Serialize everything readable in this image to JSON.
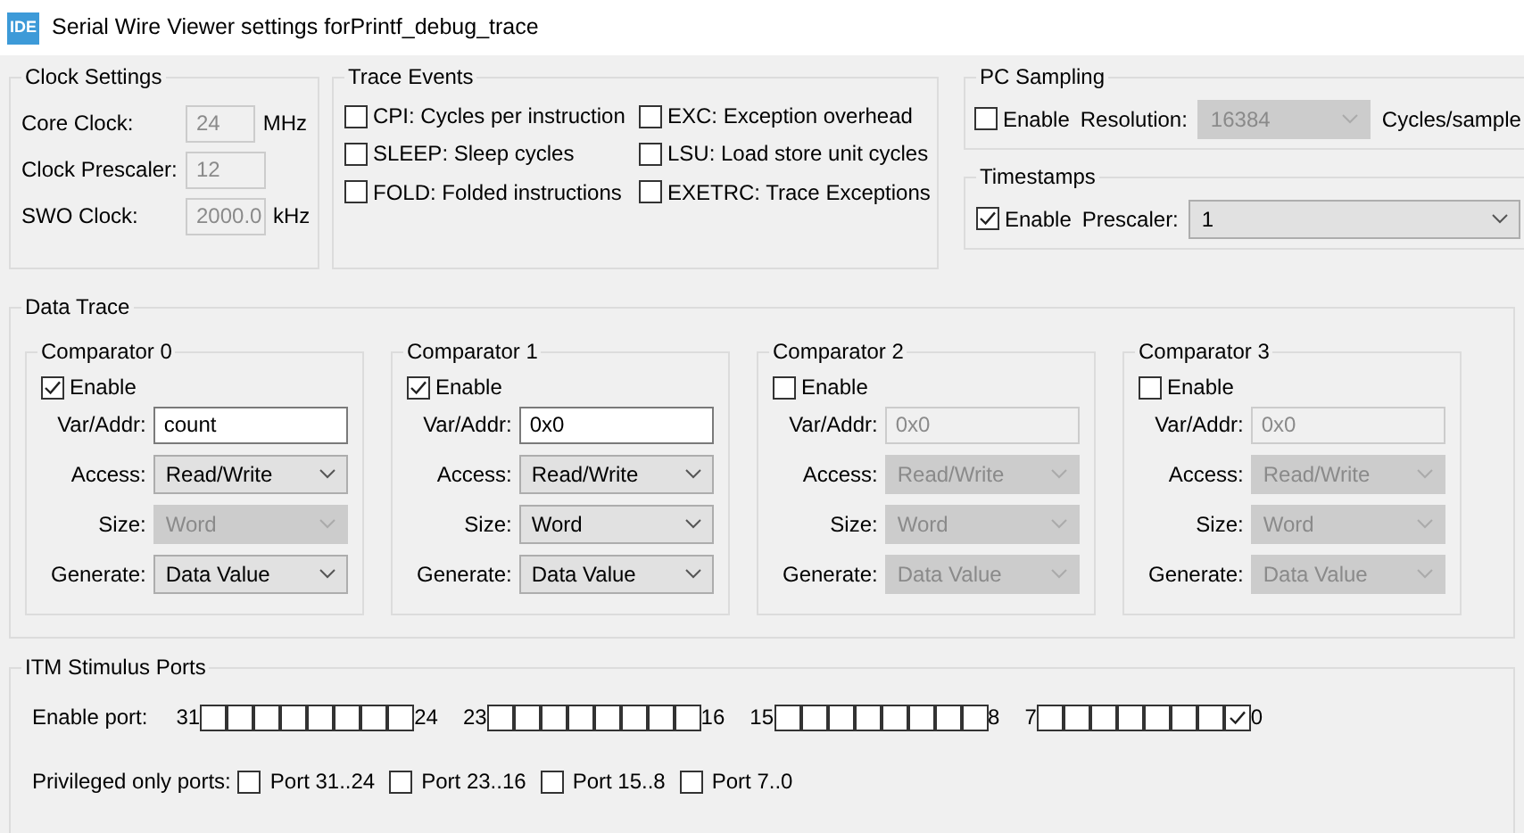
{
  "window": {
    "title": "Serial Wire Viewer settings forPrintf_debug_trace",
    "icon": "IDE"
  },
  "clock_settings": {
    "title": "Clock Settings",
    "fields": [
      {
        "label": "Core Clock:",
        "value": "24",
        "unit": "MHz"
      },
      {
        "label": "Clock Prescaler:",
        "value": "12"
      },
      {
        "label": "SWO Clock:",
        "value": "2000.0",
        "unit": "kHz"
      }
    ]
  },
  "trace_events": {
    "title": "Trace Events",
    "items": [
      {
        "label": "CPI: Cycles per instruction",
        "checked": false
      },
      {
        "label": "EXC: Exception overhead",
        "checked": false
      },
      {
        "label": "SLEEP: Sleep cycles",
        "checked": false
      },
      {
        "label": "LSU: Load store unit cycles",
        "checked": false
      },
      {
        "label": "FOLD: Folded instructions",
        "checked": false
      },
      {
        "label": "EXETRC: Trace Exceptions",
        "checked": false
      }
    ]
  },
  "pc_sampling": {
    "title": "PC Sampling",
    "enable": {
      "label": "Enable",
      "checked": false
    },
    "resolution_label": "Resolution:",
    "resolution": {
      "value": "16384",
      "disabled": true
    },
    "unit": "Cycles/sample"
  },
  "timestamps": {
    "title": "Timestamps",
    "enable": {
      "label": "Enable",
      "checked": true
    },
    "prescaler_label": "Prescaler:",
    "prescaler": {
      "value": "1",
      "disabled": false
    }
  },
  "data_trace": {
    "title": "Data Trace",
    "comparators": [
      {
        "title": "Comparator 0",
        "enable": {
          "label": "Enable",
          "checked": true
        },
        "fields": [
          {
            "label": "Var/Addr:",
            "kind": "input",
            "value": "count",
            "disabled": false
          },
          {
            "label": "Access:",
            "kind": "select",
            "value": "Read/Write",
            "disabled": false
          },
          {
            "label": "Size:",
            "kind": "select",
            "value": "Word",
            "disabled": true
          },
          {
            "label": "Generate:",
            "kind": "select",
            "value": "Data Value",
            "disabled": false
          }
        ]
      },
      {
        "title": "Comparator 1",
        "enable": {
          "label": "Enable",
          "checked": true
        },
        "fields": [
          {
            "label": "Var/Addr:",
            "kind": "input",
            "value": "0x0",
            "disabled": false
          },
          {
            "label": "Access:",
            "kind": "select",
            "value": "Read/Write",
            "disabled": false
          },
          {
            "label": "Size:",
            "kind": "select",
            "value": "Word",
            "disabled": false
          },
          {
            "label": "Generate:",
            "kind": "select",
            "value": "Data Value",
            "disabled": false
          }
        ]
      },
      {
        "title": "Comparator 2",
        "enable": {
          "label": "Enable",
          "checked": false
        },
        "fields": [
          {
            "label": "Var/Addr:",
            "kind": "input",
            "value": "0x0",
            "disabled": true
          },
          {
            "label": "Access:",
            "kind": "select",
            "value": "Read/Write",
            "disabled": true
          },
          {
            "label": "Size:",
            "kind": "select",
            "value": "Word",
            "disabled": true
          },
          {
            "label": "Generate:",
            "kind": "select",
            "value": "Data Value",
            "disabled": true
          }
        ]
      },
      {
        "title": "Comparator 3",
        "enable": {
          "label": "Enable",
          "checked": false
        },
        "fields": [
          {
            "label": "Var/Addr:",
            "kind": "input",
            "value": "0x0",
            "disabled": true
          },
          {
            "label": "Access:",
            "kind": "select",
            "value": "Read/Write",
            "disabled": true
          },
          {
            "label": "Size:",
            "kind": "select",
            "value": "Word",
            "disabled": true
          },
          {
            "label": "Generate:",
            "kind": "select",
            "value": "Data Value",
            "disabled": true
          }
        ]
      }
    ]
  },
  "itm_stimulus_ports": {
    "title": "ITM Stimulus Ports",
    "enable_port_label": "Enable port:",
    "groups": [
      {
        "high": "31",
        "low": "24",
        "ports": [
          {
            "checked": false
          },
          {
            "checked": false
          },
          {
            "checked": false
          },
          {
            "checked": false
          },
          {
            "checked": false
          },
          {
            "checked": false
          },
          {
            "checked": false
          },
          {
            "checked": false
          }
        ]
      },
      {
        "high": "23",
        "low": "16",
        "ports": [
          {
            "checked": false
          },
          {
            "checked": false
          },
          {
            "checked": false
          },
          {
            "checked": false
          },
          {
            "checked": false
          },
          {
            "checked": false
          },
          {
            "checked": false
          },
          {
            "checked": false
          }
        ]
      },
      {
        "high": "15",
        "low": "8",
        "ports": [
          {
            "checked": false
          },
          {
            "checked": false
          },
          {
            "checked": false
          },
          {
            "checked": false
          },
          {
            "checked": false
          },
          {
            "checked": false
          },
          {
            "checked": false
          },
          {
            "checked": false
          }
        ]
      },
      {
        "high": "7",
        "low": "0",
        "ports": [
          {
            "checked": false
          },
          {
            "checked": false
          },
          {
            "checked": false
          },
          {
            "checked": false
          },
          {
            "checked": false
          },
          {
            "checked": false
          },
          {
            "checked": false
          },
          {
            "checked": true
          }
        ]
      }
    ],
    "privileged_label": "Privileged only ports:",
    "privileged": [
      {
        "label": "Port 31..24",
        "checked": false
      },
      {
        "label": "Port 23..16",
        "checked": false
      },
      {
        "label": "Port 15..8",
        "checked": false
      },
      {
        "label": "Port 7..0",
        "checked": false
      }
    ]
  }
}
